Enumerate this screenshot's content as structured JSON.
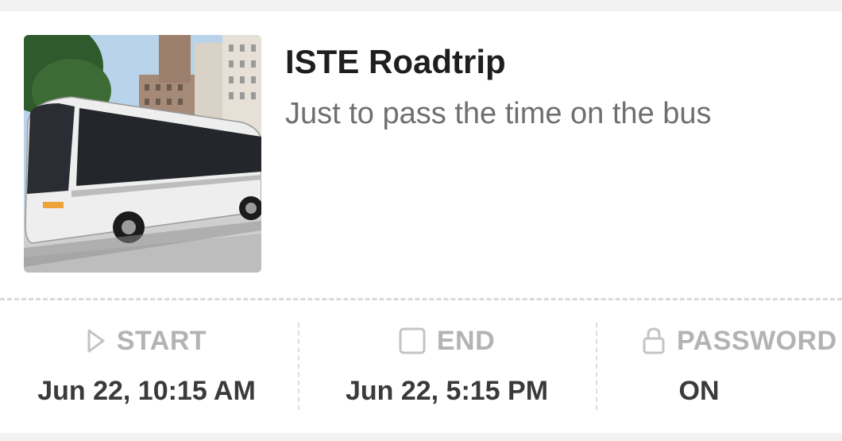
{
  "card": {
    "title": "ISTE Roadtrip",
    "description": "Just to pass the time on the bus",
    "thumbnail_alt": "charter bus photo"
  },
  "details": {
    "start": {
      "icon": "play-icon",
      "label": "START",
      "value": "Jun 22, 10:15 AM"
    },
    "end": {
      "icon": "square-icon",
      "label": "END",
      "value": "Jun 22, 5:15 PM"
    },
    "password": {
      "icon": "lock-icon",
      "label": "PASSWORD",
      "value": "ON"
    }
  },
  "colors": {
    "background": "#f2f2f2",
    "card": "#ffffff",
    "title": "#1e1e1e",
    "subtitle": "#6f6f6f",
    "label": "#b3b3b3",
    "value": "#3a3a3a",
    "divider": "#d9d9d9"
  }
}
